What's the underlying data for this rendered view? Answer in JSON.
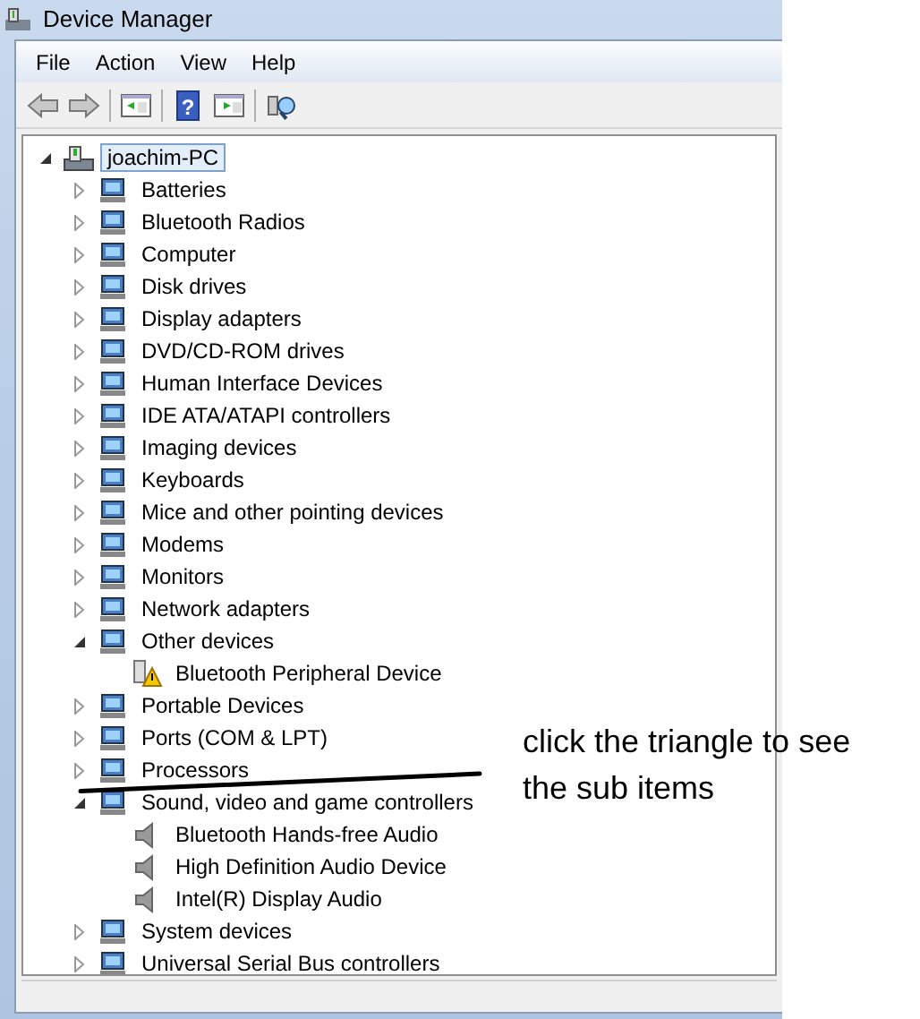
{
  "window": {
    "title": "Device Manager"
  },
  "menu": [
    "File",
    "Action",
    "View",
    "Help"
  ],
  "toolbar": [
    {
      "kind": "back",
      "disabled": true
    },
    {
      "kind": "forward",
      "disabled": true
    },
    {
      "kind": "separator"
    },
    {
      "kind": "console-tree",
      "disabled": false
    },
    {
      "kind": "separator"
    },
    {
      "kind": "help",
      "disabled": false,
      "glyph": "?"
    },
    {
      "kind": "action-pane",
      "disabled": false
    },
    {
      "kind": "separator"
    },
    {
      "kind": "scan",
      "disabled": false
    }
  ],
  "tree": [
    {
      "label": "joachim-PC",
      "expanded": true,
      "selected": true,
      "children": [
        {
          "label": "Batteries",
          "expanded": false,
          "selected": false
        },
        {
          "label": "Bluetooth Radios",
          "expanded": false,
          "selected": false
        },
        {
          "label": "Computer",
          "expanded": false,
          "selected": false
        },
        {
          "label": "Disk drives",
          "expanded": false,
          "selected": false
        },
        {
          "label": "Display adapters",
          "expanded": false,
          "selected": false
        },
        {
          "label": "DVD/CD-ROM drives",
          "expanded": false,
          "selected": false
        },
        {
          "label": "Human Interface Devices",
          "expanded": false,
          "selected": false
        },
        {
          "label": "IDE ATA/ATAPI controllers",
          "expanded": false,
          "selected": false
        },
        {
          "label": "Imaging devices",
          "expanded": false,
          "selected": false
        },
        {
          "label": "Keyboards",
          "expanded": false,
          "selected": false
        },
        {
          "label": "Mice and other pointing devices",
          "expanded": false,
          "selected": false
        },
        {
          "label": "Modems",
          "expanded": false,
          "selected": false
        },
        {
          "label": "Monitors",
          "expanded": false,
          "selected": false
        },
        {
          "label": "Network adapters",
          "expanded": false,
          "selected": false
        },
        {
          "label": "Other devices",
          "expanded": true,
          "selected": false,
          "children": [
            {
              "label": "Bluetooth Peripheral Device",
              "selected": false,
              "warning": true
            }
          ]
        },
        {
          "label": "Portable Devices",
          "expanded": false,
          "selected": false
        },
        {
          "label": "Ports (COM & LPT)",
          "expanded": false,
          "selected": false
        },
        {
          "label": "Processors",
          "expanded": false,
          "selected": false
        },
        {
          "label": "Sound, video and game controllers",
          "expanded": true,
          "selected": false,
          "children": [
            {
              "label": "Bluetooth Hands-free Audio",
              "selected": false,
              "warning": false
            },
            {
              "label": "High Definition Audio Device",
              "selected": false,
              "warning": false
            },
            {
              "label": "Intel(R) Display Audio",
              "selected": false,
              "warning": false
            }
          ]
        },
        {
          "label": "System devices",
          "expanded": false,
          "selected": false
        },
        {
          "label": "Universal Serial Bus controllers",
          "expanded": false,
          "selected": false
        }
      ]
    }
  ],
  "annotation": {
    "text": "click the triangle to see the sub items"
  }
}
